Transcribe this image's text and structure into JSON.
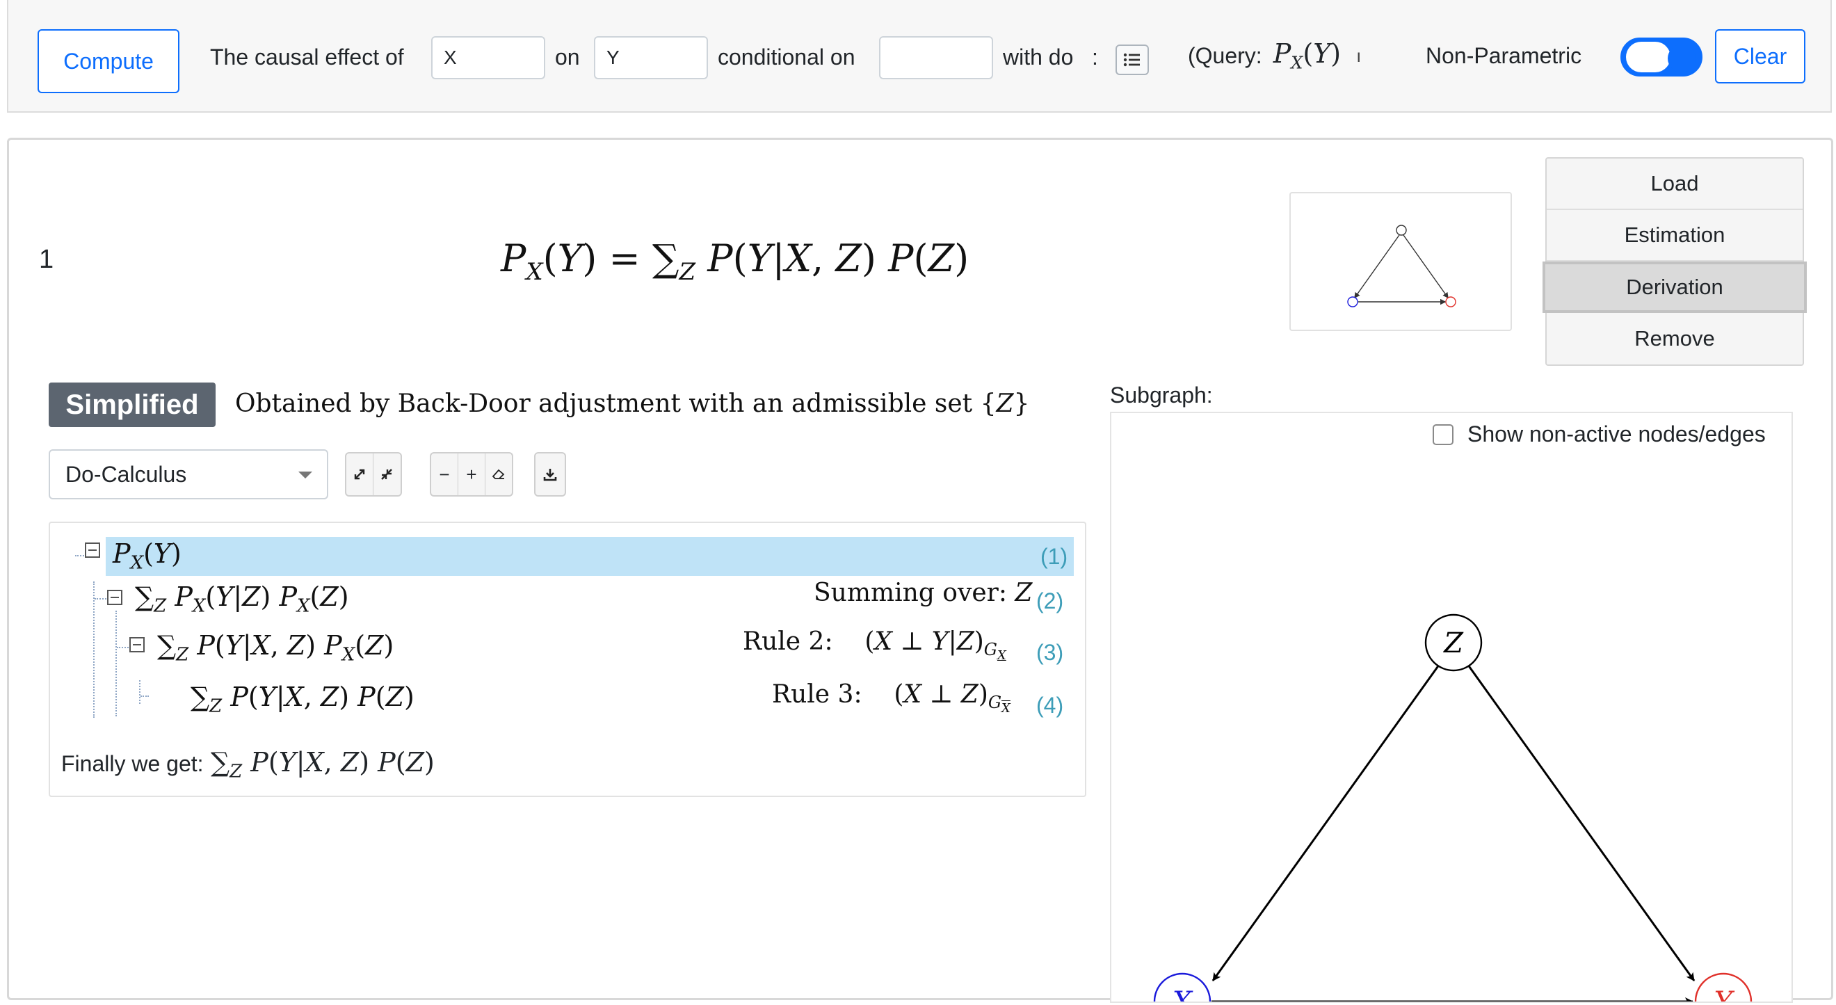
{
  "toolbar": {
    "compute_label": "Compute",
    "causal_effect_label": "The causal effect of",
    "x_value": "X",
    "on_label": "on",
    "y_value": "Y",
    "conditional_label": "conditional on",
    "conditional_value": "",
    "with_do_label": "with do",
    "colon": ":",
    "query_prefix": "(Query:",
    "query_formula": "P_X(Y)",
    "query_trailing": "ı",
    "nonparametric_label": "Non-Parametric",
    "nonparametric_on": true,
    "clear_label": "Clear"
  },
  "result": {
    "index": "1",
    "formula": "P_X(Y) = Σ_Z P(Y|X,Z) P(Z)",
    "badge": "Simplified",
    "obtained_text": "Obtained by Back-Door adjustment with an admissible set {Z}"
  },
  "menu": {
    "items": [
      "Load",
      "Estimation",
      "Derivation",
      "Remove"
    ],
    "active": "Derivation"
  },
  "controls": {
    "method_selected": "Do-Calculus"
  },
  "derivation": {
    "steps": [
      {
        "expr": "P_X(Y)",
        "annotation": "",
        "num": "(1)"
      },
      {
        "expr": "Σ_Z P_X(Y|Z) P_X(Z)",
        "annotation": "Summing over: Z",
        "num": "(2)"
      },
      {
        "expr": "Σ_Z P(Y|X,Z) P_X(Z)",
        "annotation": "Rule 2: (X ⊥ Y|Z)_G_X_under",
        "num": "(3)"
      },
      {
        "expr": "Σ_Z P(Y|X,Z) P(Z)",
        "annotation": "Rule 3: (X ⊥ Z)_G_X_over",
        "num": "(4)"
      }
    ],
    "finally_label": "Finally we get:",
    "final_formula": "Σ_Z P(Y|X,Z) P(Z)"
  },
  "subgraph": {
    "label": "Subgraph:",
    "show_nonactive_label": "Show non-active nodes/edges",
    "show_nonactive_checked": false,
    "nodes": [
      {
        "id": "Z",
        "color": "#000000"
      },
      {
        "id": "X",
        "color": "#1a1adb"
      },
      {
        "id": "Y",
        "color": "#e0302a"
      }
    ],
    "edges": [
      [
        "Z",
        "X"
      ],
      [
        "Z",
        "Y"
      ],
      [
        "X",
        "Y"
      ]
    ]
  },
  "colors": {
    "accent": "#0d6efd",
    "highlight": "#bfe3f7",
    "badge": "#5c6570",
    "step_number": "#3d9db8"
  }
}
